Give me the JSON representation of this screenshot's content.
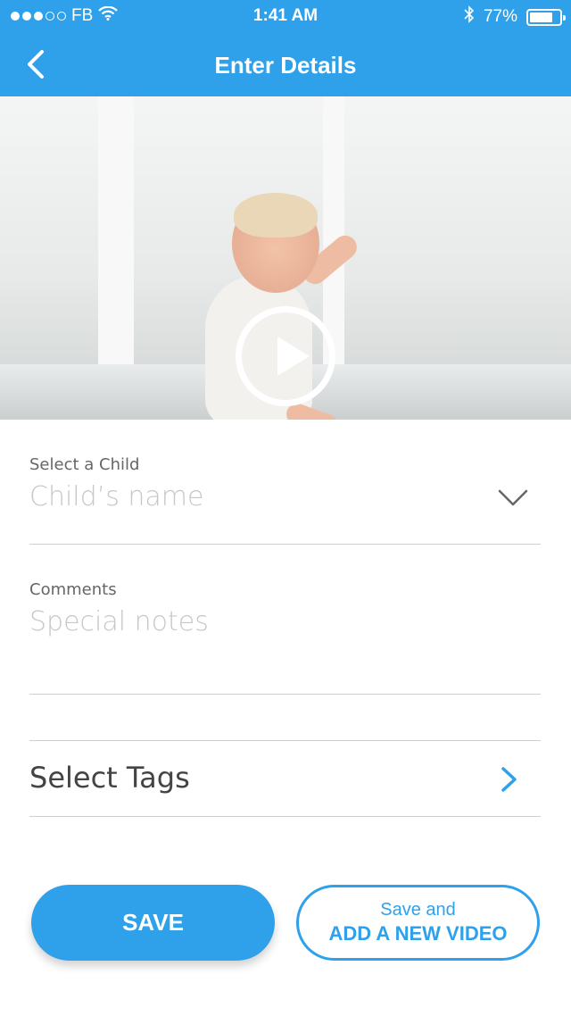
{
  "status_bar": {
    "carrier": "FB",
    "time": "1:41 AM",
    "battery_percent": "77%",
    "battery_level": 0.77,
    "signal_dots_filled": 3,
    "signal_dots_total": 5,
    "icons": [
      "wifi-icon",
      "bluetooth-icon",
      "battery-icon"
    ]
  },
  "nav": {
    "title": "Enter Details",
    "back_icon": "chevron-left-icon"
  },
  "video": {
    "play_icon": "play-icon"
  },
  "form": {
    "child": {
      "label": "Select a Child",
      "placeholder": "Child’s name",
      "icon": "chevron-down-icon"
    },
    "comments": {
      "label": "Comments",
      "placeholder": "Special notes"
    },
    "tags": {
      "label": "Select Tags",
      "icon": "chevron-right-icon"
    }
  },
  "buttons": {
    "save": "SAVE",
    "add_line1": "Save and",
    "add_line2": "ADD A NEW VIDEO"
  },
  "colors": {
    "accent": "#2ea1ea",
    "placeholder": "#c7c7c7",
    "label": "#666666"
  }
}
